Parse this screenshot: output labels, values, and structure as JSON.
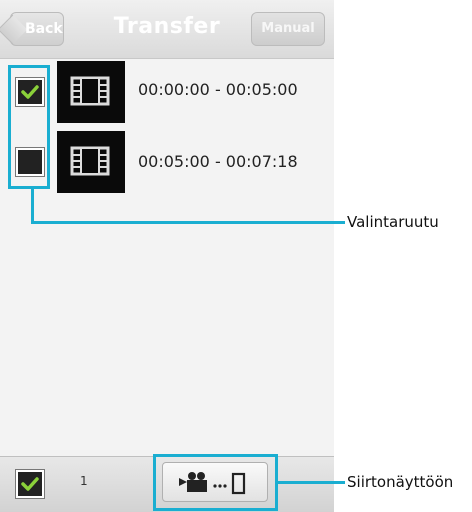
{
  "header": {
    "title": "Transfer",
    "back_label": "Back",
    "manual_label": "Manual"
  },
  "clips": [
    {
      "time": "00:00:00 - 00:05:00",
      "checked": true
    },
    {
      "time": "00:05:00 - 00:07:18",
      "checked": false
    }
  ],
  "footer": {
    "selected_count": "1",
    "select_all_checked": true
  },
  "annotations": {
    "checkbox_label": "Valintaruutu",
    "transfer_label": "Siirtonäyttöön"
  },
  "colors": {
    "accent": "#1aaed1",
    "check": "#8bd13a"
  },
  "icons": {
    "clip": "film-icon",
    "transfer": "camera-to-phone-icon"
  }
}
